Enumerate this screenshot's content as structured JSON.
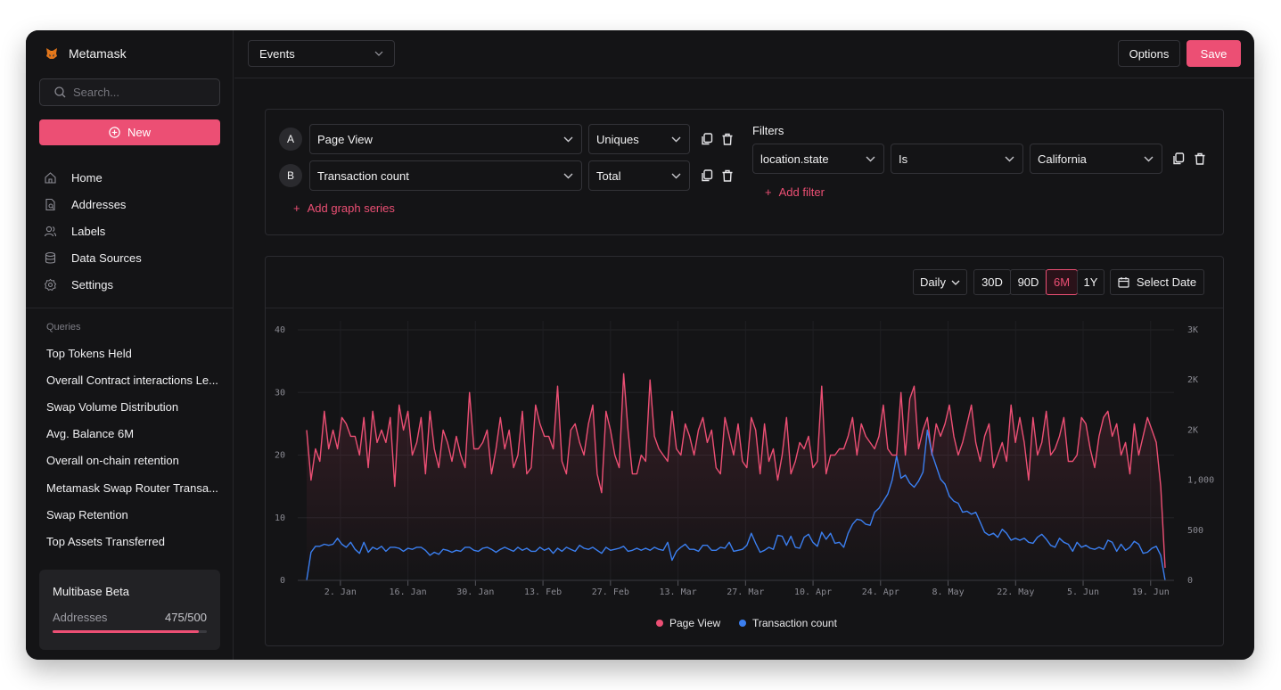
{
  "app": {
    "name": "Metamask"
  },
  "sidebar": {
    "search_placeholder": "Search...",
    "new_label": "New",
    "nav": [
      {
        "label": "Home",
        "icon": "home-icon"
      },
      {
        "label": "Addresses",
        "icon": "address-doc-icon"
      },
      {
        "label": "Labels",
        "icon": "users-icon"
      },
      {
        "label": "Data Sources",
        "icon": "database-icon"
      },
      {
        "label": "Settings",
        "icon": "gear-icon"
      }
    ],
    "queries_title": "Queries",
    "queries": [
      "Top Tokens Held",
      "Overall Contract interactions Le...",
      "Swap Volume Distribution",
      "Avg. Balance 6M",
      "Overall on-chain retention",
      "Metamask Swap Router Transa...",
      "Swap Retention",
      "Top Assets Transferred"
    ],
    "beta": {
      "title": "Multibase Beta",
      "label": "Addresses",
      "count": "475/500",
      "used": 475,
      "limit": 500
    }
  },
  "topbar": {
    "view_select": "Events",
    "options_label": "Options",
    "save_label": "Save"
  },
  "series": [
    {
      "letter": "A",
      "event": "Page View",
      "aggregation": "Uniques"
    },
    {
      "letter": "B",
      "event": "Transaction count",
      "aggregation": "Total"
    }
  ],
  "add_series_label": "Add graph series",
  "filters": {
    "label": "Filters",
    "items": [
      {
        "property": "location.state",
        "operator": "Is",
        "value": "California"
      }
    ],
    "add_label": "Add filter"
  },
  "chart_controls": {
    "interval": "Daily",
    "ranges": [
      "30D",
      "90D",
      "6M",
      "1Y"
    ],
    "active_range": "6M",
    "date_label": "Select Date"
  },
  "colors": {
    "accent": "#ec4f74",
    "blue": "#3b7ff0",
    "background": "#141416"
  },
  "chart_data": {
    "type": "line",
    "x_ticks": [
      "2. Jan",
      "16. Jan",
      "30. Jan",
      "13. Feb",
      "27. Feb",
      "13. Mar",
      "27. Mar",
      "10. Apr",
      "24. Apr",
      "8. May",
      "22. May",
      "5. Jun",
      "19. Jun"
    ],
    "x_range": [
      "2022-12-26",
      "2023-06-22"
    ],
    "y_left": {
      "ticks": [
        "0",
        "10",
        "20",
        "30",
        "40"
      ],
      "range": [
        0,
        40
      ]
    },
    "y_right": {
      "ticks": [
        "0",
        "500",
        "1,000",
        "2K",
        "2K",
        "3K"
      ],
      "range": [
        0,
        2500
      ]
    },
    "grid": true,
    "legend_position": "bottom",
    "series": [
      {
        "name": "Page View",
        "axis": "left",
        "values": [
          24,
          16,
          21,
          19,
          27,
          21,
          24,
          21,
          26,
          25,
          23,
          23,
          20,
          26,
          18,
          27,
          22,
          24,
          22,
          26,
          15,
          28,
          24,
          27,
          20,
          22,
          26,
          17,
          27,
          21,
          18,
          24,
          22,
          19,
          23,
          20,
          18,
          30,
          21,
          21,
          22,
          24,
          17,
          21,
          26,
          21,
          24,
          18,
          20,
          27,
          17,
          18,
          28,
          25,
          23,
          23,
          21,
          31,
          19,
          17,
          24,
          25,
          22,
          20,
          25,
          28,
          17,
          14,
          27,
          24,
          20,
          18,
          33,
          24,
          17,
          17,
          20,
          19,
          32,
          23,
          21,
          20,
          19,
          27,
          21,
          20,
          25,
          23,
          20,
          24,
          26,
          22,
          24,
          18,
          17,
          26,
          23,
          20,
          25,
          19,
          18,
          26,
          24,
          17,
          25,
          19,
          21,
          16,
          20,
          26,
          17,
          19,
          22,
          21,
          23,
          18,
          19,
          31,
          17,
          20,
          20,
          21,
          21,
          23,
          26,
          20,
          25,
          23,
          22,
          21,
          23,
          28,
          21,
          20,
          20,
          30,
          20,
          29,
          31,
          21,
          24,
          26,
          20,
          25,
          23,
          25,
          28,
          23,
          20,
          22,
          25,
          28,
          22,
          19,
          23,
          25,
          18,
          20,
          22,
          19,
          28,
          22,
          26,
          22,
          16,
          26,
          20,
          22,
          27,
          20,
          21,
          23,
          26,
          19,
          19,
          20,
          26,
          25,
          21,
          18,
          23,
          26,
          27,
          23,
          25,
          20,
          22,
          17,
          25,
          20,
          23,
          26,
          24,
          22,
          15,
          2
        ],
        "color": "#ec4f74"
      },
      {
        "name": "Transaction count",
        "axis": "right",
        "values": [
          0,
          280,
          340,
          340,
          360,
          350,
          360,
          420,
          360,
          330,
          380,
          310,
          270,
          380,
          280,
          330,
          310,
          340,
          290,
          330,
          330,
          320,
          290,
          320,
          310,
          330,
          330,
          300,
          250,
          280,
          260,
          310,
          300,
          280,
          300,
          290,
          330,
          330,
          300,
          290,
          320,
          330,
          310,
          280,
          310,
          330,
          310,
          290,
          330,
          300,
          320,
          290,
          290,
          330,
          300,
          320,
          270,
          320,
          290,
          330,
          310,
          290,
          350,
          320,
          310,
          330,
          300,
          270,
          330,
          300,
          310,
          320,
          340,
          290,
          300,
          320,
          300,
          320,
          300,
          330,
          310,
          300,
          380,
          200,
          290,
          330,
          360,
          310,
          310,
          290,
          350,
          350,
          300,
          300,
          330,
          320,
          380,
          290,
          300,
          310,
          350,
          470,
          370,
          280,
          300,
          330,
          310,
          450,
          440,
          350,
          440,
          330,
          320,
          430,
          460,
          380,
          340,
          480,
          410,
          470,
          370,
          380,
          330,
          470,
          560,
          610,
          600,
          560,
          550,
          680,
          720,
          790,
          860,
          1000,
          1240,
          1020,
          1050,
          970,
          930,
          990,
          1080,
          1500,
          1270,
          1140,
          1010,
          960,
          840,
          790,
          770,
          680,
          690,
          660,
          680,
          580,
          480,
          450,
          470,
          430,
          510,
          470,
          400,
          420,
          400,
          420,
          380,
          370,
          430,
          460,
          410,
          350,
          330,
          420,
          380,
          360,
          290,
          380,
          330,
          350,
          320,
          310,
          330,
          310,
          400,
          380,
          290,
          360,
          300,
          330,
          390,
          360,
          270,
          280,
          320,
          340,
          250,
          0
        ],
        "color": "#3b7ff0"
      }
    ]
  }
}
